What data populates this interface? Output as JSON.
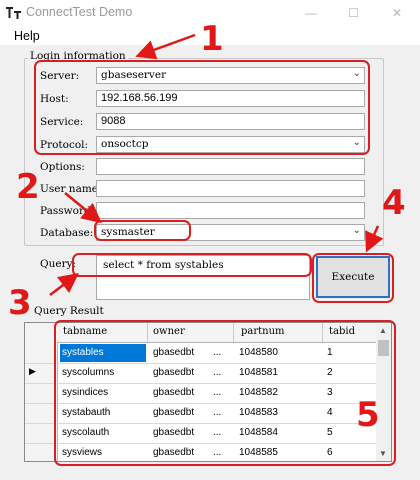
{
  "window": {
    "title": "ConnectTest Demo",
    "minimize": "—",
    "maximize": "☐",
    "close": "✕"
  },
  "menu": {
    "help": "Help"
  },
  "login": {
    "group_label": "Login information",
    "server_label": "Server:",
    "server_value": "gbaseserver",
    "host_label": "Host:",
    "host_value": "192.168.56.199",
    "service_label": "Service:",
    "service_value": "9088",
    "protocol_label": "Protocol:",
    "protocol_value": "onsoctcp",
    "options_label": "Options:",
    "options_value": "",
    "username_label": "User name:",
    "username_value": "",
    "password_label": "Password:",
    "password_value": "",
    "database_label": "Database:",
    "database_value": "sysmaster"
  },
  "query": {
    "label": "Query:",
    "value": "select * from systables"
  },
  "execute_label": "Execute",
  "result": {
    "label": "Query Result",
    "columns": [
      "tabname",
      "owner",
      "partnum",
      "tabid"
    ],
    "rows": [
      [
        "systables",
        "gbasedbt",
        "...",
        "1048580",
        "1"
      ],
      [
        "syscolumns",
        "gbasedbt",
        "...",
        "1048581",
        "2"
      ],
      [
        "sysindices",
        "gbasedbt",
        "...",
        "1048582",
        "3"
      ],
      [
        "systabauth",
        "gbasedbt",
        "...",
        "1048583",
        "4"
      ],
      [
        "syscolauth",
        "gbasedbt",
        "...",
        "1048584",
        "5"
      ],
      [
        "sysviews",
        "gbasedbt",
        "...",
        "1048585",
        "6"
      ]
    ]
  },
  "annotations": [
    "1",
    "2",
    "3",
    "4",
    "5"
  ],
  "colors": {
    "annotation": "#e01818",
    "selection": "#0078d7",
    "button_border": "#2f6fc4"
  }
}
